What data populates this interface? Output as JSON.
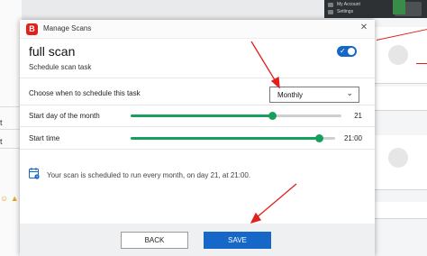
{
  "dialog": {
    "title": "Manage Scans",
    "logo_letter": "B",
    "close_glyph": "✕",
    "scan_name": "full scan",
    "subtitle": "Schedule scan task",
    "enabled": true
  },
  "schedule": {
    "label": "Choose when to schedule this task",
    "selected": "Monthly",
    "chevron": "⌄"
  },
  "start_day": {
    "label": "Start day of the month",
    "value": "21",
    "fraction": 0.67
  },
  "start_time": {
    "label": "Start time",
    "value": "21:00",
    "fraction": 0.92
  },
  "info": {
    "text": "Your scan is scheduled to run every month, on day 21, at 21:00."
  },
  "buttons": {
    "back": "BACK",
    "save": "SAVE"
  },
  "background": {
    "menu_items": [
      "My Account",
      "Settings"
    ]
  },
  "colors": {
    "accent": "#1667c8",
    "slider": "#17a05d",
    "brand": "#e0201c",
    "annotation": "#e0201c"
  },
  "icons": [
    "app-logo-icon",
    "close-icon",
    "toggle-check-icon",
    "chevron-down-icon",
    "calendar-icon",
    "annotation-arrow"
  ]
}
